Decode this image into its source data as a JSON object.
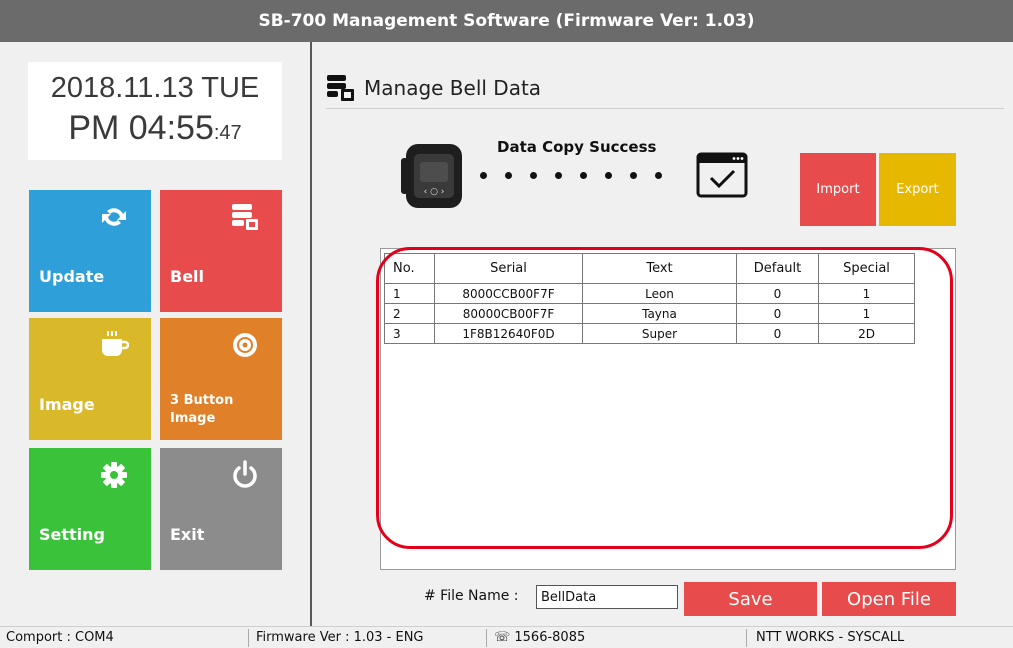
{
  "window": {
    "title": "SB-700 Management Software (Firmware Ver: 1.03)"
  },
  "clock": {
    "date": "2018.11.13 TUE",
    "time": "PM 04:55",
    "seconds": ":47"
  },
  "tiles": [
    {
      "label": "Update",
      "icon": "refresh-icon",
      "color": "#2e9fd8"
    },
    {
      "label": "Bell",
      "icon": "database-icon",
      "color": "#e84b4b"
    },
    {
      "label": "Image",
      "icon": "coffee-cup-icon",
      "color": "#d9b82a"
    },
    {
      "label_line1": "3 Button",
      "label_line2": "Image",
      "icon": "food-icon",
      "color": "#e0812a"
    },
    {
      "label": "Setting",
      "icon": "gear-icon",
      "color": "#3bc23b"
    },
    {
      "label": "Exit",
      "icon": "power-icon",
      "color": "#8c8c8c"
    }
  ],
  "section": {
    "title": "Manage Bell Data",
    "icon": "database-icon"
  },
  "transfer": {
    "status": "Data Copy Success"
  },
  "actions": {
    "import_label": "Import",
    "import_color": "#e84b4b",
    "export_label": "Export",
    "export_color": "#e6b800",
    "save_label": "Save",
    "open_label": "Open File",
    "button_color": "#e84b4b"
  },
  "table": {
    "columns": [
      "No.",
      "Serial",
      "Text",
      "Default",
      "Special"
    ],
    "rows": [
      [
        "1",
        "8000CCB00F7F",
        "Leon",
        "0",
        "1"
      ],
      [
        "2",
        "80000CB00F7F",
        "Tayna",
        "0",
        "1"
      ],
      [
        "3",
        "1F8B12640F0D",
        "Super",
        "0",
        "2D"
      ]
    ]
  },
  "file": {
    "label": "# File Name :",
    "value": "BellData"
  },
  "statusbar": {
    "comport": "Comport : COM4",
    "firmware": "Firmware Ver : 1.03 - ENG",
    "phone": "☏ 1566-8085",
    "company": "NTT WORKS - SYSCALL"
  }
}
